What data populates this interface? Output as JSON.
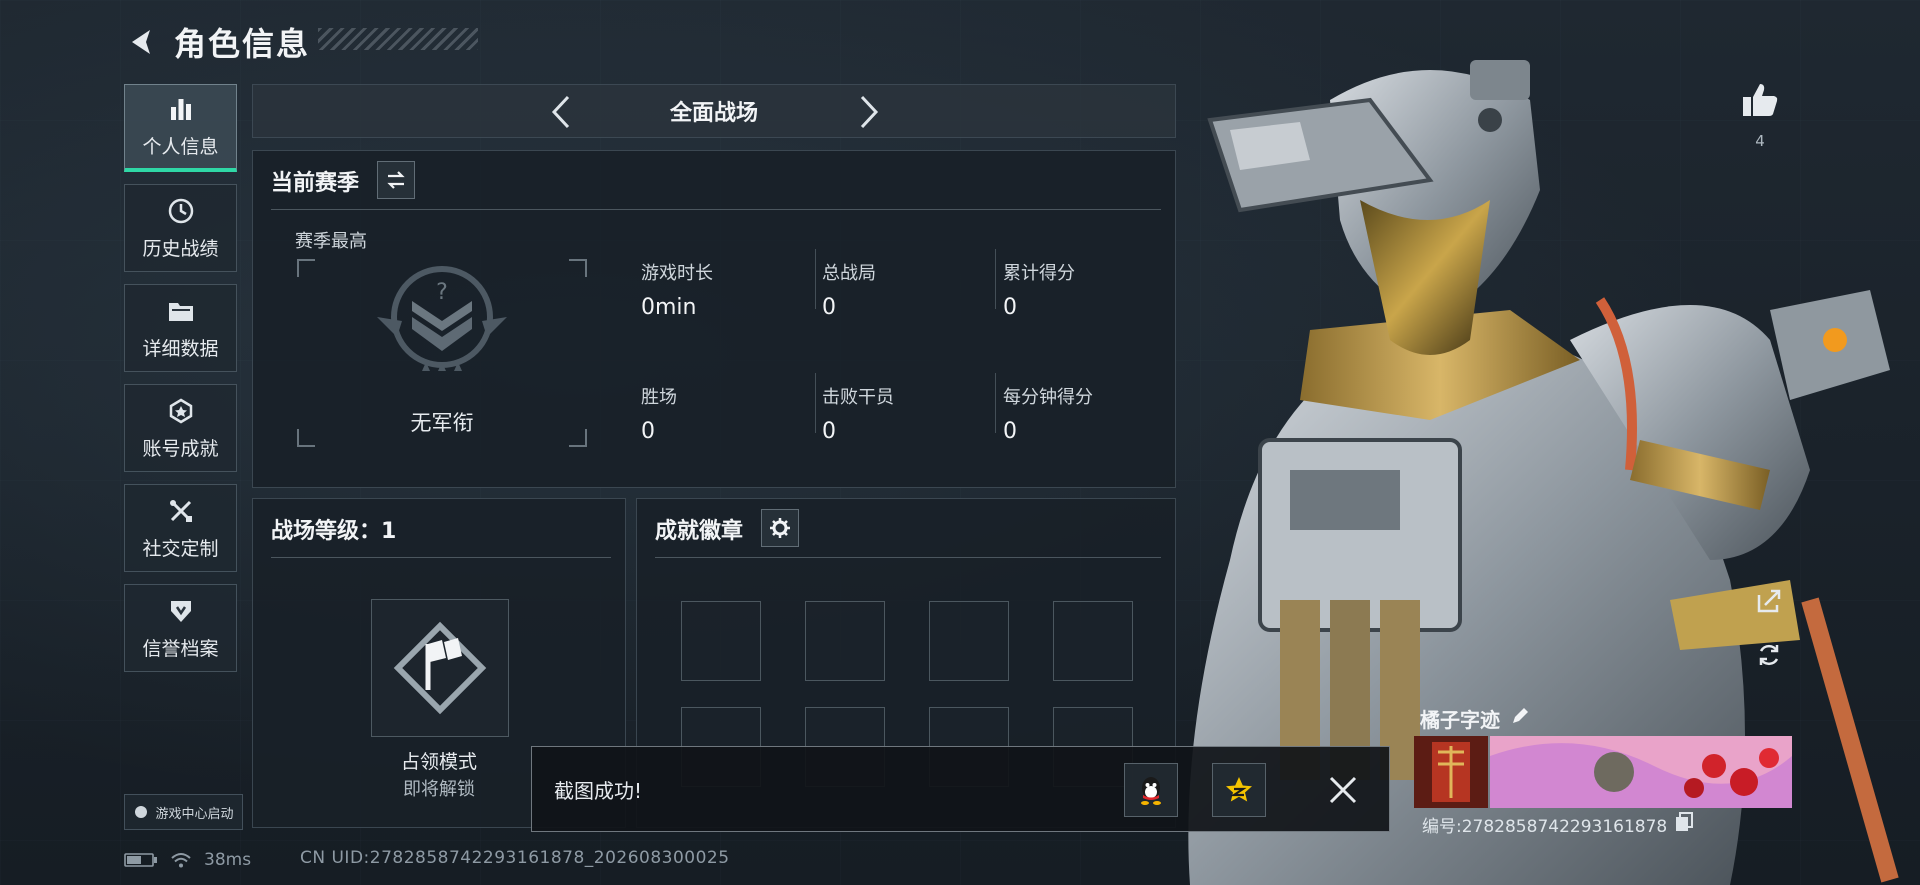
{
  "header": {
    "title": "角色信息"
  },
  "sidebar": {
    "items": [
      {
        "label": "个人信息",
        "icon": "bar-chart-icon",
        "active": true
      },
      {
        "label": "历史战绩",
        "icon": "history-icon"
      },
      {
        "label": "详细数据",
        "icon": "folder-icon"
      },
      {
        "label": "账号成就",
        "icon": "achievement-icon"
      },
      {
        "label": "社交定制",
        "icon": "tools-icon"
      },
      {
        "label": "信誉档案",
        "icon": "shield-icon"
      }
    ],
    "bottom_label": "游戏中心启动"
  },
  "status": {
    "ping": "38ms",
    "uid": "CN UID:2782858742293161878_202608300025"
  },
  "mode": {
    "title": "全面战场"
  },
  "season": {
    "title": "当前赛季",
    "subtitle": "赛季最高",
    "rank": "无军衔",
    "stats": [
      {
        "label": "游戏时长",
        "value": "0min"
      },
      {
        "label": "总战局",
        "value": "0"
      },
      {
        "label": "累计得分",
        "value": "0"
      },
      {
        "label": "胜场",
        "value": "0"
      },
      {
        "label": "击败干员",
        "value": "0"
      },
      {
        "label": "每分钟得分",
        "value": "0"
      }
    ]
  },
  "battlefield": {
    "title": "战场等级：1",
    "mode_name": "占领模式",
    "mode_status": "即将解锁"
  },
  "badges": {
    "title": "成就徽章",
    "slot_count": 8
  },
  "toast": {
    "message": "截图成功!"
  },
  "likes": {
    "count": "4"
  },
  "card": {
    "name": "橘子字迹",
    "id": "编号:2782858742293161878"
  },
  "colors": {
    "accent": "#2fd8a6",
    "panel": "#18202a",
    "background": "#1b232b"
  }
}
